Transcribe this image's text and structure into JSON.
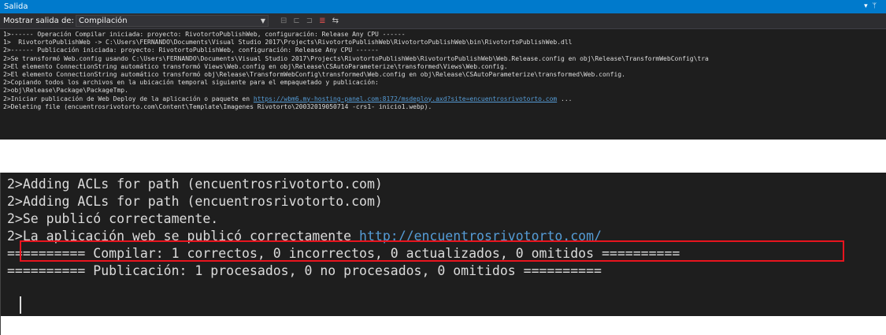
{
  "output_panel": {
    "title": "Salida",
    "window_controls": "▾ ᛘ",
    "show_output_from_label": "Mostrar salida de:",
    "show_output_from_value": "Compilación",
    "lines": [
      {
        "text": "1>------ Operación Compilar iniciada: proyecto: RivotortoPublishWeb, configuración: Release Any CPU ------"
      },
      {
        "text": "1>  RivotortoPublishWeb -> C:\\Users\\FERNANDO\\Documents\\Visual Studio 2017\\Projects\\RivotortoPublishWeb\\RivotortoPublishWeb\\bin\\RivotortoPublishWeb.dll"
      },
      {
        "text": "2>------ Publicación iniciada: proyecto: RivotortoPublishWeb, configuración: Release Any CPU ------"
      },
      {
        "text": "2>Se transformó Web.config usando C:\\Users\\FERNANDO\\Documents\\Visual Studio 2017\\Projects\\RivotortoPublishWeb\\RivotortoPublishWeb\\Web.Release.config en obj\\Release\\TransformWebConfig\\tra"
      },
      {
        "text": "2>El elemento ConnectionString automático transformó Views\\Web.config en obj\\Release\\CSAutoParameterize\\transformed\\Views\\Web.config."
      },
      {
        "text": "2>El elemento ConnectionString automático transformó obj\\Release\\TransformWebConfig\\transformed\\Web.config en obj\\Release\\CSAutoParameterize\\transformed\\Web.config."
      },
      {
        "text": "2>Copiando todos los archivos en la ubicación temporal siguiente para el empaquetado y publicación:"
      },
      {
        "text": "2>obj\\Release\\Package\\PackageTmp."
      },
      {
        "text": "2>Iniciar publicación de Web Deploy de la aplicación o paquete en ",
        "link": "https://wbm6.my-hosting-panel.com:8172/msdeploy.axd?site=encuentrosrivotorto.com",
        "suffix": " ..."
      },
      {
        "text": "2>Deleting file (encuentrosrivotorto.com\\Content\\Template\\Imagenes Rivotorto\\20032019050714 -crs1- inicio1.webp)."
      }
    ]
  },
  "zoomed_output": {
    "lines": [
      {
        "text": "2>Adding ACLs for path (encuentrosrivotorto.com)"
      },
      {
        "text": "2>Adding ACLs for path (encuentrosrivotorto.com)"
      },
      {
        "text": "2>Se publicó correctamente."
      },
      {
        "text": "2>La aplicación web se publicó correctamente ",
        "link": "http://encuentrosrivotorto.com/"
      },
      {
        "text": "========== Compilar: 1 correctos, 0 incorrectos, 0 actualizados, 0 omitidos =========="
      },
      {
        "text": "========== Publicación: 1 procesados, 0 no procesados, 0 omitidos =========="
      }
    ]
  },
  "colors": {
    "title_bar": "#007acc",
    "toolbar": "#2d2d30",
    "editor_bg": "#1e1e1e",
    "text": "#dcdcdc",
    "link": "#569cd6",
    "highlight_box": "#e8141e"
  },
  "icons": [
    "clear-icon",
    "prev-message-icon",
    "next-message-icon",
    "toggle-word-wrap-icon",
    "find-icon"
  ]
}
